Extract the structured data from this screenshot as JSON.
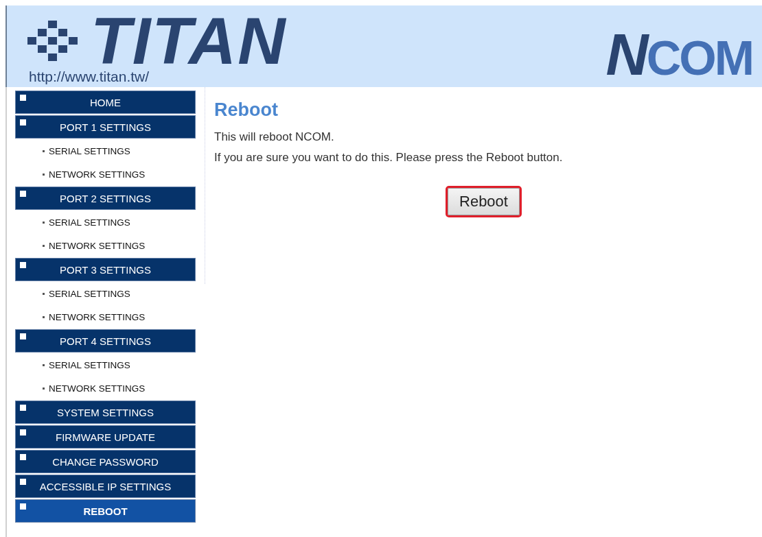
{
  "header": {
    "brand": "TITAN",
    "url": "http://www.titan.tw/",
    "product_logo": "NCOM"
  },
  "menu": [
    {
      "kind": "section",
      "label": "HOME",
      "selected": false
    },
    {
      "kind": "section",
      "label": "PORT 1 SETTINGS",
      "selected": false
    },
    {
      "kind": "sub",
      "label": "SERIAL SETTINGS",
      "selected": false
    },
    {
      "kind": "sub",
      "label": "NETWORK SETTINGS",
      "selected": false
    },
    {
      "kind": "section",
      "label": "PORT 2 SETTINGS",
      "selected": false
    },
    {
      "kind": "sub",
      "label": "SERIAL SETTINGS",
      "selected": false
    },
    {
      "kind": "sub",
      "label": "NETWORK SETTINGS",
      "selected": false
    },
    {
      "kind": "section",
      "label": "PORT 3 SETTINGS",
      "selected": false
    },
    {
      "kind": "sub",
      "label": "SERIAL SETTINGS",
      "selected": false
    },
    {
      "kind": "sub",
      "label": "NETWORK SETTINGS",
      "selected": false
    },
    {
      "kind": "section",
      "label": "PORT 4 SETTINGS",
      "selected": false
    },
    {
      "kind": "sub",
      "label": "SERIAL SETTINGS",
      "selected": false
    },
    {
      "kind": "sub",
      "label": "NETWORK SETTINGS",
      "selected": false
    },
    {
      "kind": "section",
      "label": "SYSTEM SETTINGS",
      "selected": false
    },
    {
      "kind": "section",
      "label": "FIRMWARE UPDATE",
      "selected": false
    },
    {
      "kind": "section",
      "label": "CHANGE PASSWORD",
      "selected": false
    },
    {
      "kind": "section",
      "label": "ACCESSIBLE IP SETTINGS",
      "selected": false
    },
    {
      "kind": "section",
      "label": "REBOOT",
      "selected": true
    }
  ],
  "content": {
    "title": "Reboot",
    "lines": [
      "This will reboot NCOM.",
      "If you are sure you want to do this. Please press the Reboot button."
    ],
    "button": {
      "label": "Reboot",
      "focused": true
    }
  }
}
